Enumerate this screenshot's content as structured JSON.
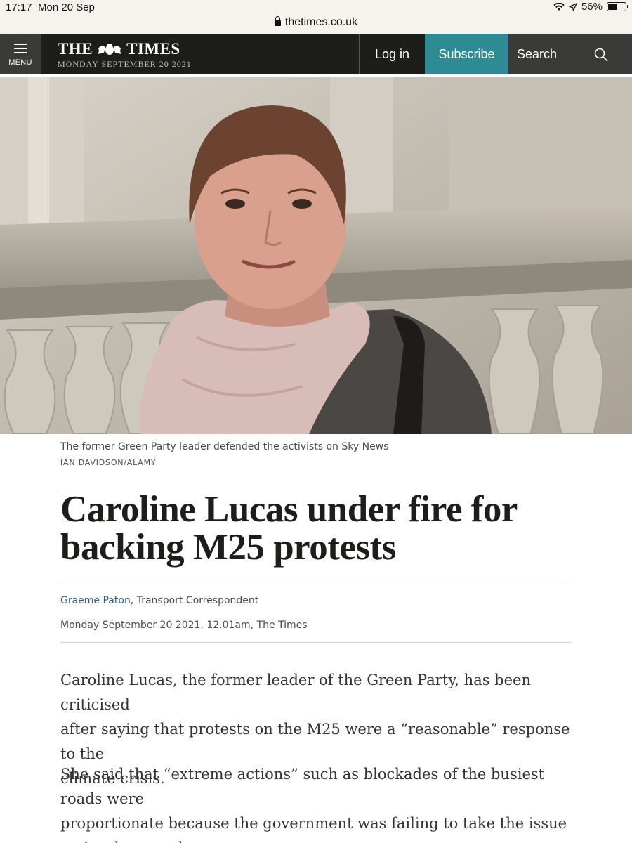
{
  "status_bar": {
    "time": "17:17",
    "date": "Mon 20 Sep",
    "battery_text": "56%",
    "battery_level": 0.56
  },
  "url_bar": {
    "domain": "thetimes.co.uk"
  },
  "header": {
    "menu_label": "MENU",
    "logo_left": "THE",
    "logo_right": "TIMES",
    "dateline": "MONDAY SEPTEMBER 20 2021",
    "login_label": "Log in",
    "subscribe_label": "Subscribe",
    "search_label": "Search",
    "subscribe_color": "#2e8a93"
  },
  "article": {
    "caption": "The former Green Party leader defended the activists on Sky News",
    "credit": "IAN DAVIDSON/ALAMY",
    "headline_line1": "Caroline Lucas under fire for",
    "headline_line2": "backing M25 protests",
    "author": "Graeme Paton",
    "author_role": ", Transport Correspondent",
    "pubdate": "Monday September 20 2021, 12.01am, The Times",
    "paragraphs": [
      {
        "line1": "Caroline Lucas, the former leader of the Green Party, has been criticised",
        "line2": "after saying that protests on the M25 were a “reasonable” response to the",
        "line3": "climate crisis."
      },
      {
        "line1": "She said that “extreme actions” such as blockades of the busiest roads were",
        "line2": "proportionate because the government was failing to take the issue",
        "line3": "seriously enough."
      }
    ]
  }
}
